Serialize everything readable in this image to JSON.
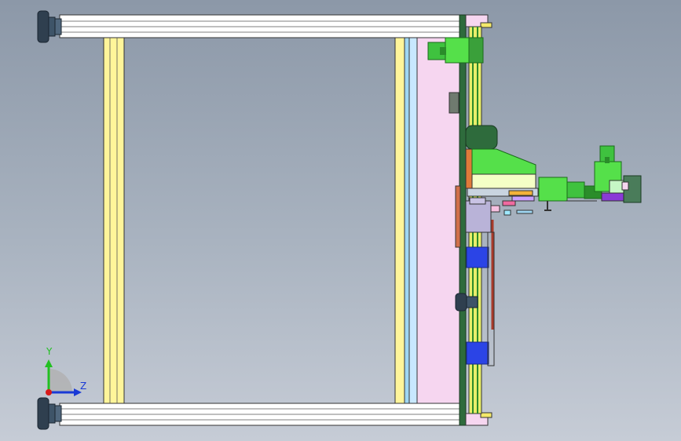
{
  "viewport": {
    "background_top": "#8c98a8",
    "background_bottom": "#c6ccd6"
  },
  "triad": {
    "y_label": "Y",
    "z_label": "Z",
    "y_color": "#22c022",
    "z_color": "#1a3ad6",
    "x_color": "#d81a1a"
  },
  "colors": {
    "frame_white": "#ffffff",
    "frame_yellow": "#fff59a",
    "panel_pink": "#f6d6f0",
    "rail_green": "#2e6b3c",
    "motor_green": "#55e04a",
    "carriage_blue": "#2b44e6",
    "slide_gray": "#b9b3d8",
    "accent_orange": "#e07a3a",
    "foot_dark": "#2f3f4f"
  }
}
